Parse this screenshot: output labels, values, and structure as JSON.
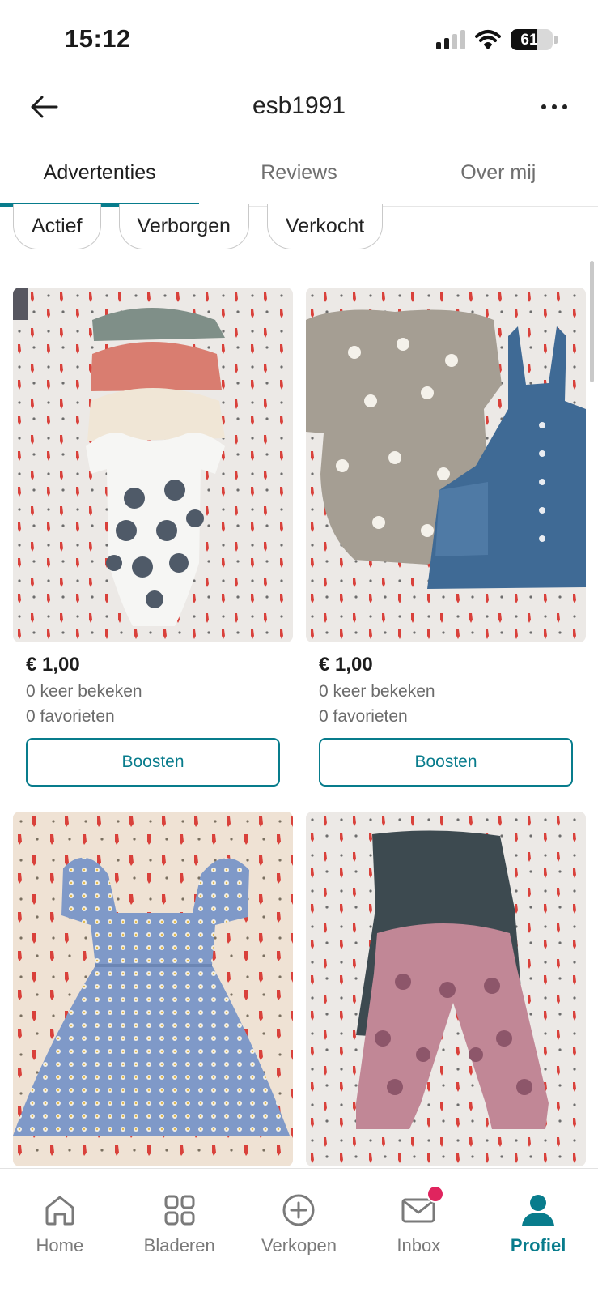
{
  "status_bar": {
    "time": "15:12",
    "battery": "61",
    "battery_level": 0.61
  },
  "header": {
    "title": "esb1991"
  },
  "tabs": [
    {
      "label": "Advertenties",
      "active": true
    },
    {
      "label": "Reviews",
      "active": false
    },
    {
      "label": "Over mij",
      "active": false
    }
  ],
  "filters": [
    {
      "label": "Actief"
    },
    {
      "label": "Verborgen"
    },
    {
      "label": "Verkocht"
    }
  ],
  "items": [
    {
      "price": "€ 1,00",
      "views": "0 keer bekeken",
      "favorites": "0 favorieten",
      "boost_label": "Boosten"
    },
    {
      "price": "€ 1,00",
      "views": "0 keer bekeken",
      "favorites": "0 favorieten",
      "boost_label": "Boosten"
    },
    {
      "price": "",
      "views": "",
      "favorites": "",
      "boost_label": ""
    },
    {
      "price": "",
      "views": "",
      "favorites": "",
      "boost_label": ""
    }
  ],
  "bottom_nav": [
    {
      "label": "Home",
      "icon": "home-icon",
      "active": false
    },
    {
      "label": "Bladeren",
      "icon": "grid-icon",
      "active": false
    },
    {
      "label": "Verkopen",
      "icon": "plus-circle-icon",
      "active": false
    },
    {
      "label": "Inbox",
      "icon": "mail-icon",
      "active": false,
      "badge": true
    },
    {
      "label": "Profiel",
      "icon": "user-icon",
      "active": true
    }
  ],
  "colors": {
    "accent": "#087c8c",
    "badge": "#e0245e"
  }
}
